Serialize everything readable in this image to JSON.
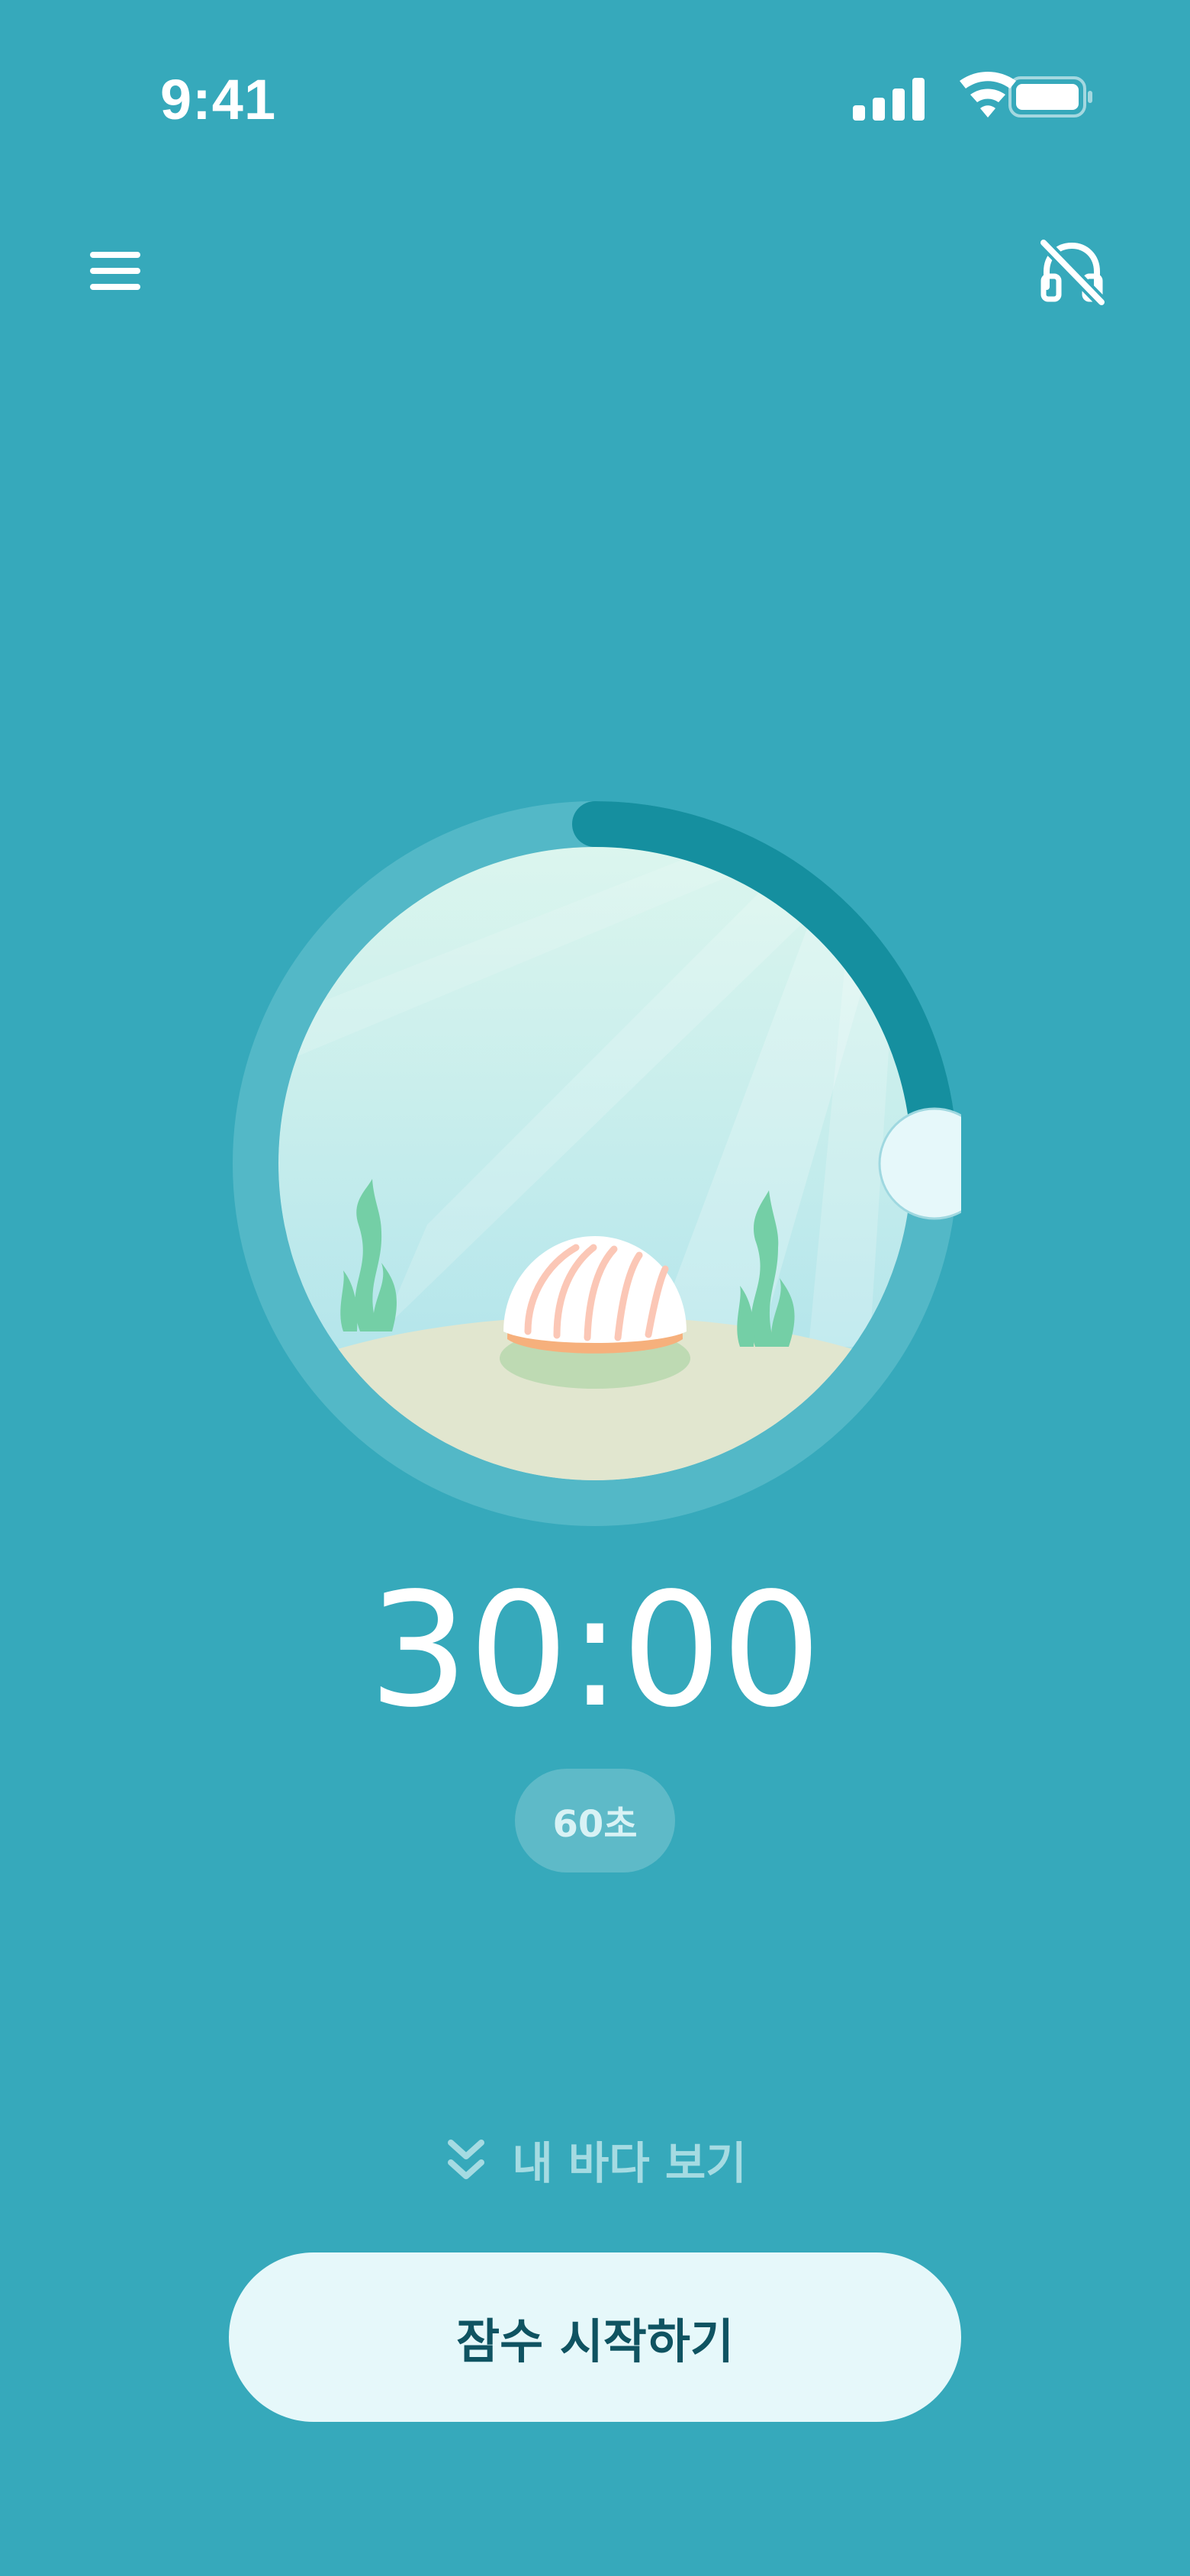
{
  "status_bar": {
    "time": "9:41"
  },
  "header": {
    "menu_icon": "hamburger-menu-icon",
    "sound_icon": "headphones-off-icon"
  },
  "dial": {
    "progress": 0.25,
    "track_color": "#53b8c7",
    "progress_color": "#158f9f",
    "handle_color": "#e6f8fa"
  },
  "timer": {
    "display": "30:00",
    "interval_badge": "60초"
  },
  "my_sea": {
    "label": "내 바다 보기",
    "icon": "double-chevron-down-icon"
  },
  "start_button": {
    "label": "잠수 시작하기"
  },
  "colors": {
    "background": "#36a9bb",
    "button_bg": "#e6f8fa",
    "button_text": "#0f5361"
  }
}
